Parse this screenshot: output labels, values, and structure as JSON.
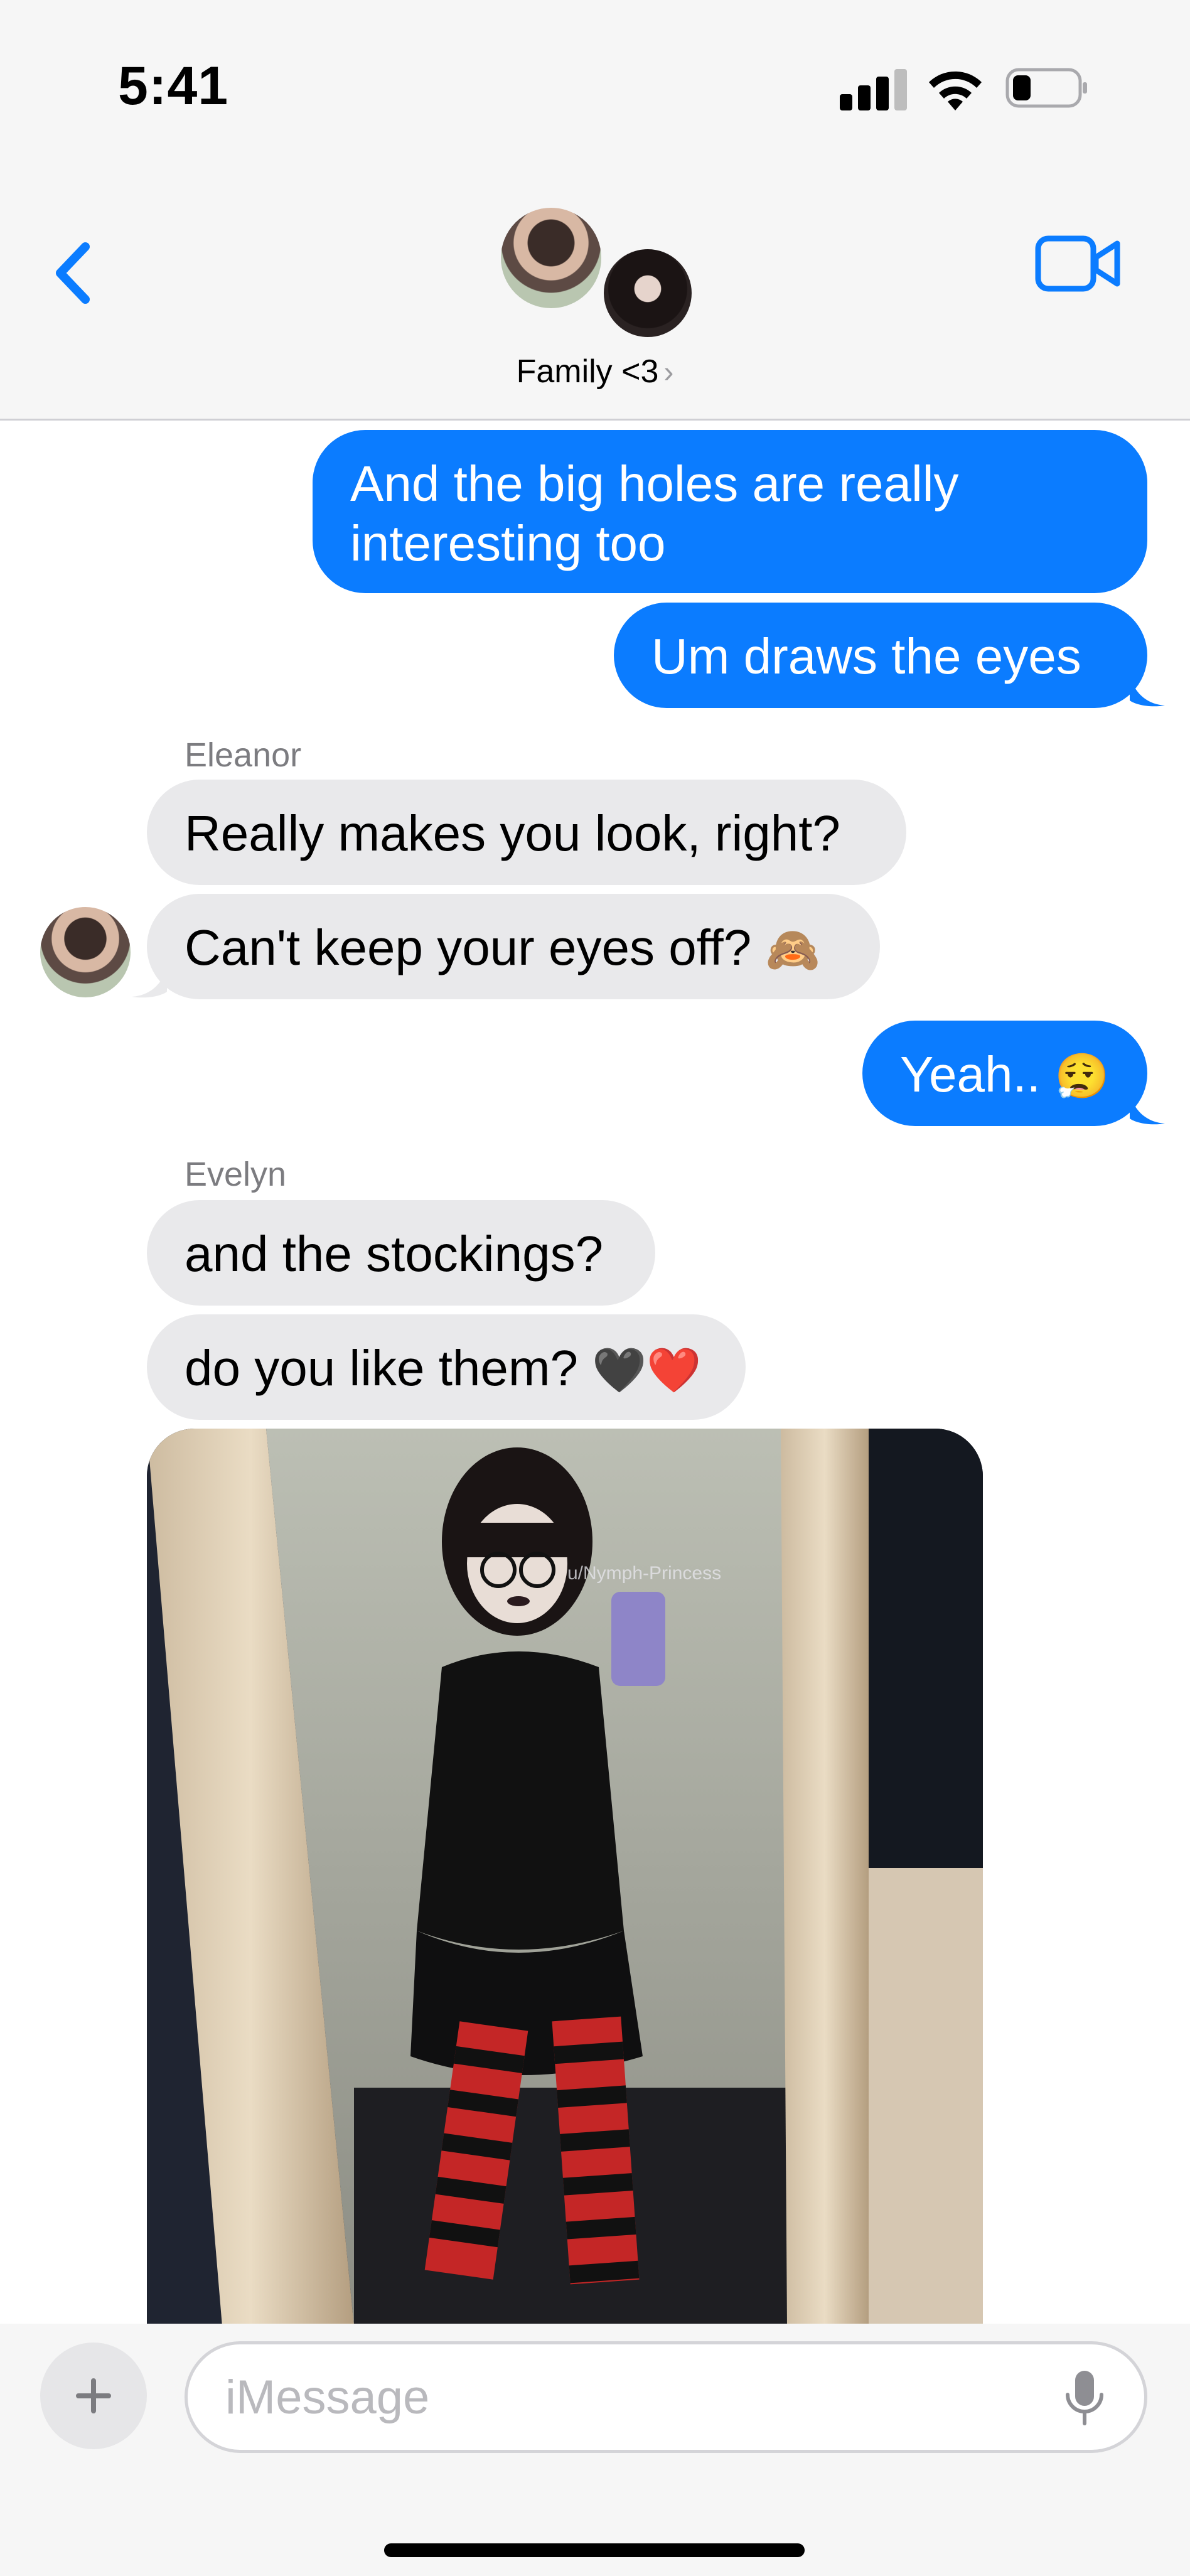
{
  "status_bar": {
    "time": "5:41",
    "icons": [
      "cellular-signal-icon",
      "wifi-icon",
      "battery-icon"
    ]
  },
  "header": {
    "back_icon": "chevron-left-icon",
    "group_name": "Family <3",
    "chevron": "›",
    "video_icon": "video-camera-icon",
    "accent_color": "#0b7cff"
  },
  "messages": [
    {
      "direction": "outgoing",
      "text": "And the big holes are really interesting too"
    },
    {
      "direction": "outgoing",
      "text": "Um draws the eyes"
    },
    {
      "direction": "incoming",
      "sender": "Eleanor",
      "text": "Really makes you look, right?"
    },
    {
      "direction": "incoming",
      "text": "Can't keep your eyes off?",
      "emoji": "🙈"
    },
    {
      "direction": "outgoing",
      "text": "Yeah..",
      "emoji": "😮‍💨"
    },
    {
      "direction": "incoming",
      "sender": "Evelyn",
      "text": "and the stockings?"
    },
    {
      "direction": "incoming",
      "text": "do you like them?",
      "emoji": "🖤❤️"
    },
    {
      "direction": "incoming",
      "type": "photo",
      "watermark": "u/Nymph-Princess"
    }
  ],
  "composer": {
    "placeholder": "iMessage",
    "value": "",
    "plus_icon": "plus-icon",
    "mic_icon": "microphone-icon"
  },
  "colors": {
    "outgoing_bubble": "#0b7cff",
    "incoming_bubble": "#e9e9eb",
    "sender_label": "#7c7c80"
  }
}
